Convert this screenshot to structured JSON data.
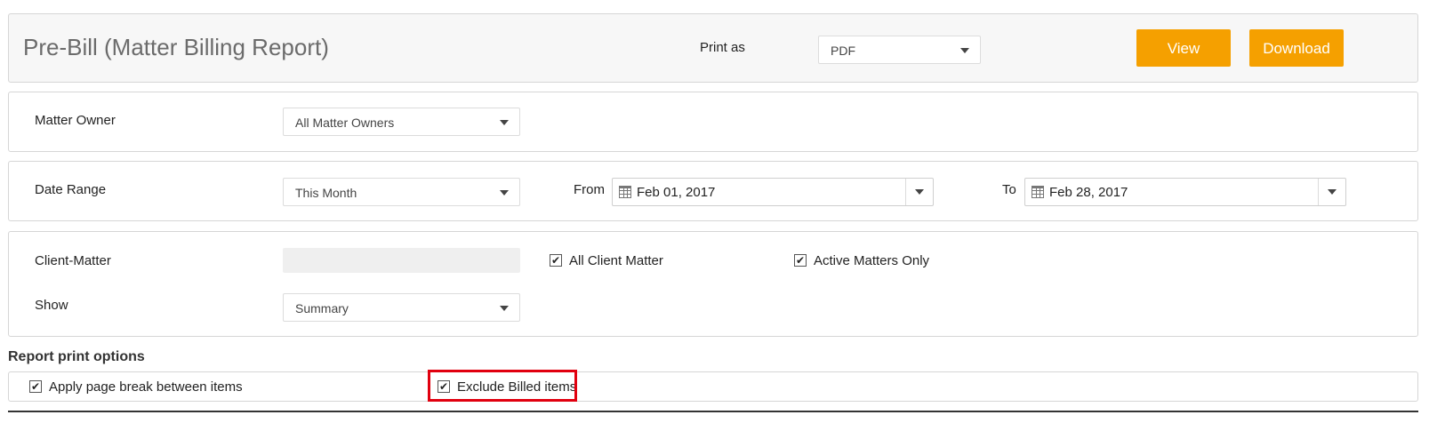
{
  "header": {
    "title": "Pre-Bill (Matter Billing Report)",
    "print_as_label": "Print as",
    "print_as_value": "PDF",
    "view_button": "View",
    "download_button": "Download"
  },
  "matter_owner": {
    "label": "Matter Owner",
    "value": "All Matter Owners"
  },
  "date_range": {
    "label": "Date Range",
    "value": "This Month",
    "from_label": "From",
    "from_value": "Feb 01, 2017",
    "to_label": "To",
    "to_value": "Feb 28, 2017"
  },
  "client_matter": {
    "label": "Client-Matter",
    "all_client_matter": {
      "label": "All Client Matter",
      "checked": true
    },
    "active_matters_only": {
      "label": "Active Matters Only",
      "checked": true
    }
  },
  "show": {
    "label": "Show",
    "value": "Summary"
  },
  "report_print_options": {
    "title": "Report print options",
    "page_break": {
      "label": "Apply page break between items",
      "checked": true
    },
    "exclude_billed": {
      "label": "Exclude Billed items",
      "checked": true
    }
  },
  "colors": {
    "accent": "#f5a000",
    "highlight": "#e1000f",
    "border": "#d6d6d6"
  },
  "icons": {
    "check": "✔",
    "calendar": "calendar-icon",
    "caret": "chevron-down-icon"
  }
}
